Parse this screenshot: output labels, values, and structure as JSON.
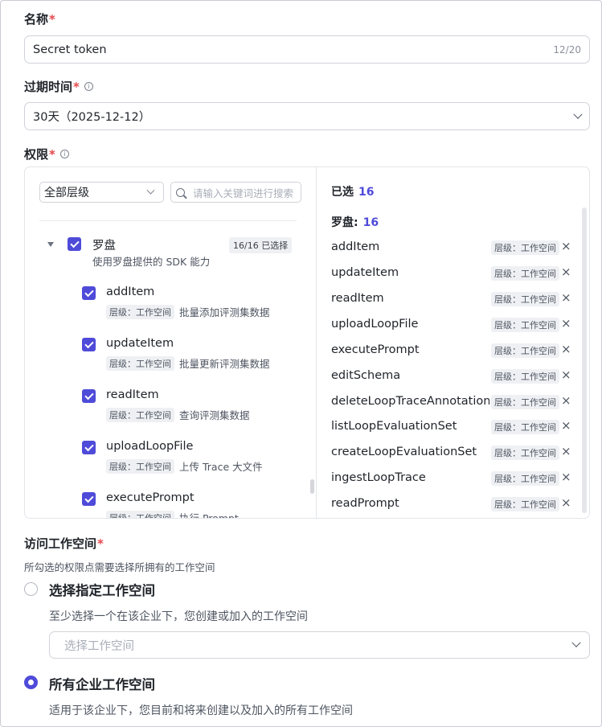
{
  "name_field": {
    "label": "名称",
    "required_mark": "*",
    "value": "Secret token",
    "counter": "12/20"
  },
  "expiry_field": {
    "label": "过期时间",
    "required_mark": "*",
    "value": "30天（2025-12-12）"
  },
  "permissions": {
    "label": "权限",
    "required_mark": "*",
    "level_filter": "全部层级",
    "search_placeholder": "请输入关键词进行搜索",
    "group": {
      "title": "罗盘",
      "desc": "使用罗盘提供的 SDK 能力",
      "badge": "16/16 已选择"
    },
    "items": [
      {
        "name": "addItem",
        "tag": "层级：工作空间",
        "desc": "批量添加评测集数据"
      },
      {
        "name": "updateItem",
        "tag": "层级：工作空间",
        "desc": "批量更新评测集数据"
      },
      {
        "name": "readItem",
        "tag": "层级：工作空间",
        "desc": "查询评测集数据"
      },
      {
        "name": "uploadLoopFile",
        "tag": "层级：工作空间",
        "desc": "上传 Trace 大文件"
      },
      {
        "name": "executePrompt",
        "tag": "层级：工作空间",
        "desc": "执行 Prompt"
      }
    ],
    "selected": {
      "title": "已选",
      "count": "16",
      "group_title": "罗盘:",
      "group_count": "16",
      "items": [
        {
          "name": "addItem",
          "tag": "层级：工作空间"
        },
        {
          "name": "updateItem",
          "tag": "层级：工作空间"
        },
        {
          "name": "readItem",
          "tag": "层级：工作空间"
        },
        {
          "name": "uploadLoopFile",
          "tag": "层级：工作空间"
        },
        {
          "name": "executePrompt",
          "tag": "层级：工作空间"
        },
        {
          "name": "editSchema",
          "tag": "层级：工作空间"
        },
        {
          "name": "deleteLoopTraceAnnotation",
          "tag": "层级：工作空间"
        },
        {
          "name": "listLoopEvaluationSet",
          "tag": "层级：工作空间"
        },
        {
          "name": "createLoopEvaluationSet",
          "tag": "层级：工作空间"
        },
        {
          "name": "ingestLoopTrace",
          "tag": "层级：工作空间"
        },
        {
          "name": "readPrompt",
          "tag": "层级：工作空间"
        }
      ],
      "remove_glyph": "×"
    }
  },
  "workspace": {
    "label": "访问工作空间",
    "required_mark": "*",
    "note": "所勾选的权限点需要选择所拥有的工作空间",
    "option_specific": {
      "label": "选择指定工作空间",
      "desc": "至少选择一个在该企业下，您创建或加入的工作空间",
      "placeholder": "选择工作空间",
      "selected": false
    },
    "option_all": {
      "label": "所有企业工作空间",
      "desc": "适用于该企业下，您目前和将来创建以及加入的所有工作空间",
      "selected": true
    }
  },
  "colors": {
    "accent": "#4f4bd9",
    "required": "#e5484d"
  }
}
